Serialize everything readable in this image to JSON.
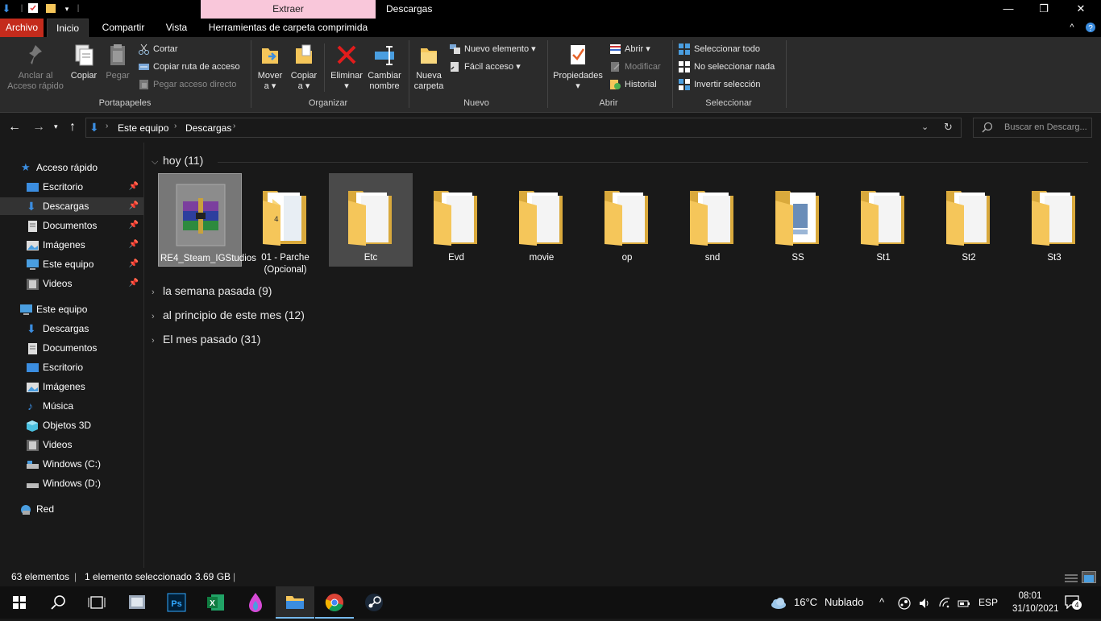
{
  "window": {
    "title": "Descargas",
    "context_tab": "Extraer",
    "controls": {
      "minimize": "—",
      "maximize": "❐",
      "close": "✕"
    }
  },
  "tabs": [
    "Archivo",
    "Inicio",
    "Compartir",
    "Vista",
    "Herramientas de carpeta comprimida"
  ],
  "ribbon": {
    "portapapeles": {
      "label": "Portapapeles",
      "pin_label_1": "Anclar al",
      "pin_label_2": "Acceso rápido",
      "copy": "Copiar",
      "paste": "Pegar",
      "cut": "Cortar",
      "copy_path": "Copiar ruta de acceso",
      "paste_shortcut": "Pegar acceso directo"
    },
    "organizar": {
      "label": "Organizar",
      "move_1": "Mover",
      "move_2": "a ▾",
      "copyto_1": "Copiar",
      "copyto_2": "a ▾",
      "delete_1": "Eliminar",
      "delete_2": "▾",
      "rename_1": "Cambiar",
      "rename_2": "nombre"
    },
    "nuevo": {
      "label": "Nuevo",
      "new_folder_1": "Nueva",
      "new_folder_2": "carpeta",
      "new_item": "Nuevo elemento ▾",
      "easy_access": "Fácil acceso ▾"
    },
    "abrir": {
      "label": "Abrir",
      "properties": "Propiedades",
      "properties_arrow": "▾",
      "open": "Abrir ▾",
      "edit": "Modificar",
      "history": "Historial"
    },
    "seleccionar": {
      "label": "Seleccionar",
      "select_all": "Seleccionar todo",
      "select_none": "No seleccionar nada",
      "invert": "Invertir selección"
    }
  },
  "address": {
    "crumbs": [
      "Este equipo",
      "Descargas"
    ],
    "search_placeholder": "Buscar en Descarg..."
  },
  "nav": {
    "quick_access": "Acceso rápido",
    "quick_items": [
      "Escritorio",
      "Descargas",
      "Documentos",
      "Imágenes",
      "Este equipo",
      "Videos"
    ],
    "this_pc": "Este equipo",
    "pc_items": [
      "Descargas",
      "Documentos",
      "Escritorio",
      "Imágenes",
      "Música",
      "Objetos 3D",
      "Videos",
      "Windows (C:)",
      "Windows (D:)"
    ],
    "network": "Red"
  },
  "groups": {
    "today": "hoy (11)",
    "last_week": "la semana pasada (9)",
    "month_start": "al principio de este mes (12)",
    "last_month": "El mes pasado (31)"
  },
  "files": [
    {
      "name": "RE4_Steam_IGStudios",
      "type": "rar"
    },
    {
      "name": "01 - Parche (Opcional)",
      "type": "folder"
    },
    {
      "name": "Etc",
      "type": "folder"
    },
    {
      "name": "Evd",
      "type": "folder"
    },
    {
      "name": "movie",
      "type": "folder"
    },
    {
      "name": "op",
      "type": "folder"
    },
    {
      "name": "snd",
      "type": "folder"
    },
    {
      "name": "SS",
      "type": "folder"
    },
    {
      "name": "St1",
      "type": "folder"
    },
    {
      "name": "St2",
      "type": "folder"
    },
    {
      "name": "St3",
      "type": "folder"
    }
  ],
  "status": {
    "count": "63 elementos",
    "selected": "1 elemento seleccionado",
    "size": "3.69 GB"
  },
  "taskbar": {
    "weather_temp": "16°C",
    "weather_desc": "Nublado",
    "lang": "ESP",
    "time": "08:01",
    "date": "31/10/2021",
    "notifications": "4"
  },
  "colors": {
    "archivo_tab": "#c42b1c",
    "context_tab": "#f9c7da",
    "folder": "#f5c65a",
    "accent": "#76b9ed"
  }
}
